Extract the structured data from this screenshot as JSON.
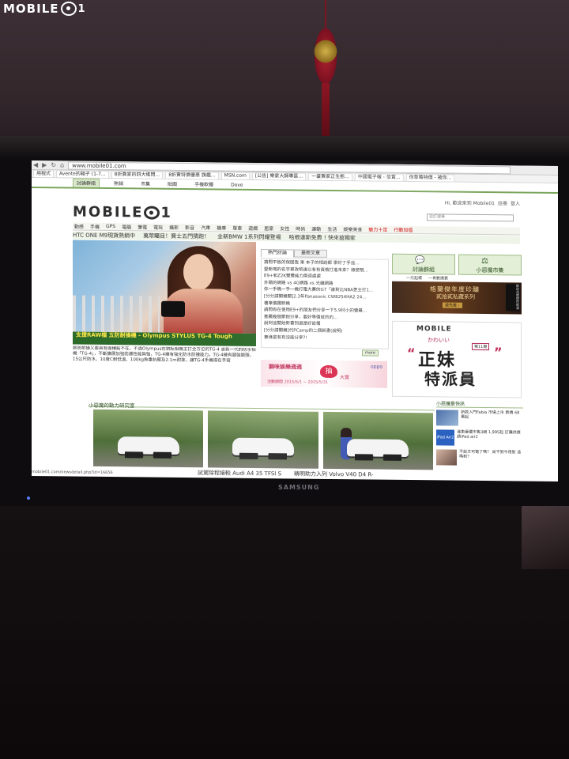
{
  "watermark": {
    "text": "MOBILE",
    "suffix": "1"
  },
  "browser": {
    "url": "www.mobile01.com",
    "bookmarks": [
      "用程式",
      "Avente的箱子 (1-7...",
      "8折賣家的四大維問...",
      "8折賣特價優惠 旗艦...",
      "MSN.com",
      "[公告] 樂家大歸專區...",
      "一臺賣家正生態...",
      "中國電子報 - 信賞...",
      "你草莓特價 - 被你..."
    ],
    "status_url": "mobile01.com/newsdetail.php?id=16656"
  },
  "site": {
    "subtabs": [
      "討論群組",
      "熱銷",
      "市集",
      "貼圖",
      "手機軟體",
      "Dove"
    ],
    "header_links": [
      "Hi, 歡迎來到 Mobile01",
      "註冊",
      "登入"
    ],
    "search_placeholder": "自訂搜尋",
    "logo_text": "MOBILE",
    "logo_suffix": "1",
    "main_nav": [
      "動感",
      "手機",
      "GPS",
      "電腦",
      "筆電",
      "電玩",
      "攝影",
      "影音",
      "汽車",
      "機車",
      "單車",
      "遊戲",
      "居家",
      "女性",
      "時尚",
      "運動",
      "生活",
      "娛樂美食",
      "魅力十足",
      "行動加值"
    ],
    "headlines": [
      "HTC ONE M9現貨熱銷中",
      "萬眾矚目！寶士五門猜跑！",
      "全新BMW 1系列閃耀登場",
      "哈根達斯免費 ! 快來搶獨家"
    ],
    "hero": {
      "caption": "支援RAW檔 五防耐操機 - Olympus STYLUS TG-4 Tough",
      "text": "韌防耐操又要具有面積點不在，不過Olympus在耕耘相機主打全方位的TG-4 更新一代的防水相機「TG-4」，不斷擴展加強防護性能與強，TG-4擁有強化防水防撞能力。TG-4擁有超強鏡頭，15公尺防水、10度C耐低溫、100kg負重抗壓及2.1m耐摔，讓TG-4手機得在手寫"
    },
    "news_tabs": [
      "熱門討論",
      "最新文章"
    ],
    "news_items": [
      "搞問平板的保固我 果 本子的相說都 學好了手這…",
      "愛新嘅的名字單改吧達以有有資格打進未來？順便現…",
      "E9+和Z2K雙雙能力兩道處處",
      "外頭的網路 vs 4G網路 vs 光纖網路",
      "你一手機一手一機打電大賽的G7「誰對比NBA更主打1…",
      "[分分請關機關]2.3年Panasonic CW8254HA2 24…",
      "樓車價獨新機",
      "請問有在使用E9+的朋友們分享一下5.9村小的螢幕…",
      "推薦幾個聚耐分享，要好等價就的的…",
      "說到這開始新書到過是好設備",
      "[分分請關機]代PCamp的二個新書(說明)",
      "東綠是有有沒能分享?!"
    ],
    "more_label": "more",
    "ad_banner": {
      "title": "獅咪娛樂週週",
      "date": "活動期間 2015/5/1 ~ 2015/5/31",
      "big": "抽",
      "oppo": "oppo",
      "sub": "大賞"
    },
    "right_buttons": [
      "討論群組",
      "小惡魔市集"
    ],
    "right_minitabs": [
      "一元起標",
      "一肯數擔賣"
    ],
    "whisky_ad": {
      "line1": "格蘭傑年度珍釀",
      "line2": "貳拾貳私藏系列",
      "cta": "搶先看 ›",
      "side": "歡迎品嚐理性飲酒"
    },
    "cover": {
      "logo": "MOBILE",
      "kawaii": "かわいい",
      "big1": "正妹",
      "big2": "特派員",
      "issue": "第11期"
    },
    "section_title": "小惡魔的動力研究室",
    "thumb_captions": [
      "試駕除程接較 Audi A4 35 TFSI S",
      "精明助力入列 Volvo V40 D4 R-"
    ],
    "side_news_title": "小惡魔最快訊",
    "side_news": [
      {
        "img": "car",
        "text": "新款入門Fabia 市場上市 賣價 68萬起"
      },
      {
        "img": "ipad",
        "label": "iPad Air2",
        "text": "遠東最優市售3網 1,995起 訂購供應 請iPad air2"
      },
      {
        "img": "girl",
        "text": "不說文可電了嗎？ 尚不到今用對 這嗎和？"
      }
    ]
  },
  "tv": {
    "brand": "SAMSUNG"
  },
  "colors": {
    "brand_green": "#2c6b2a",
    "caption_yellow": "#ffe84a",
    "accent_red": "#c00"
  }
}
